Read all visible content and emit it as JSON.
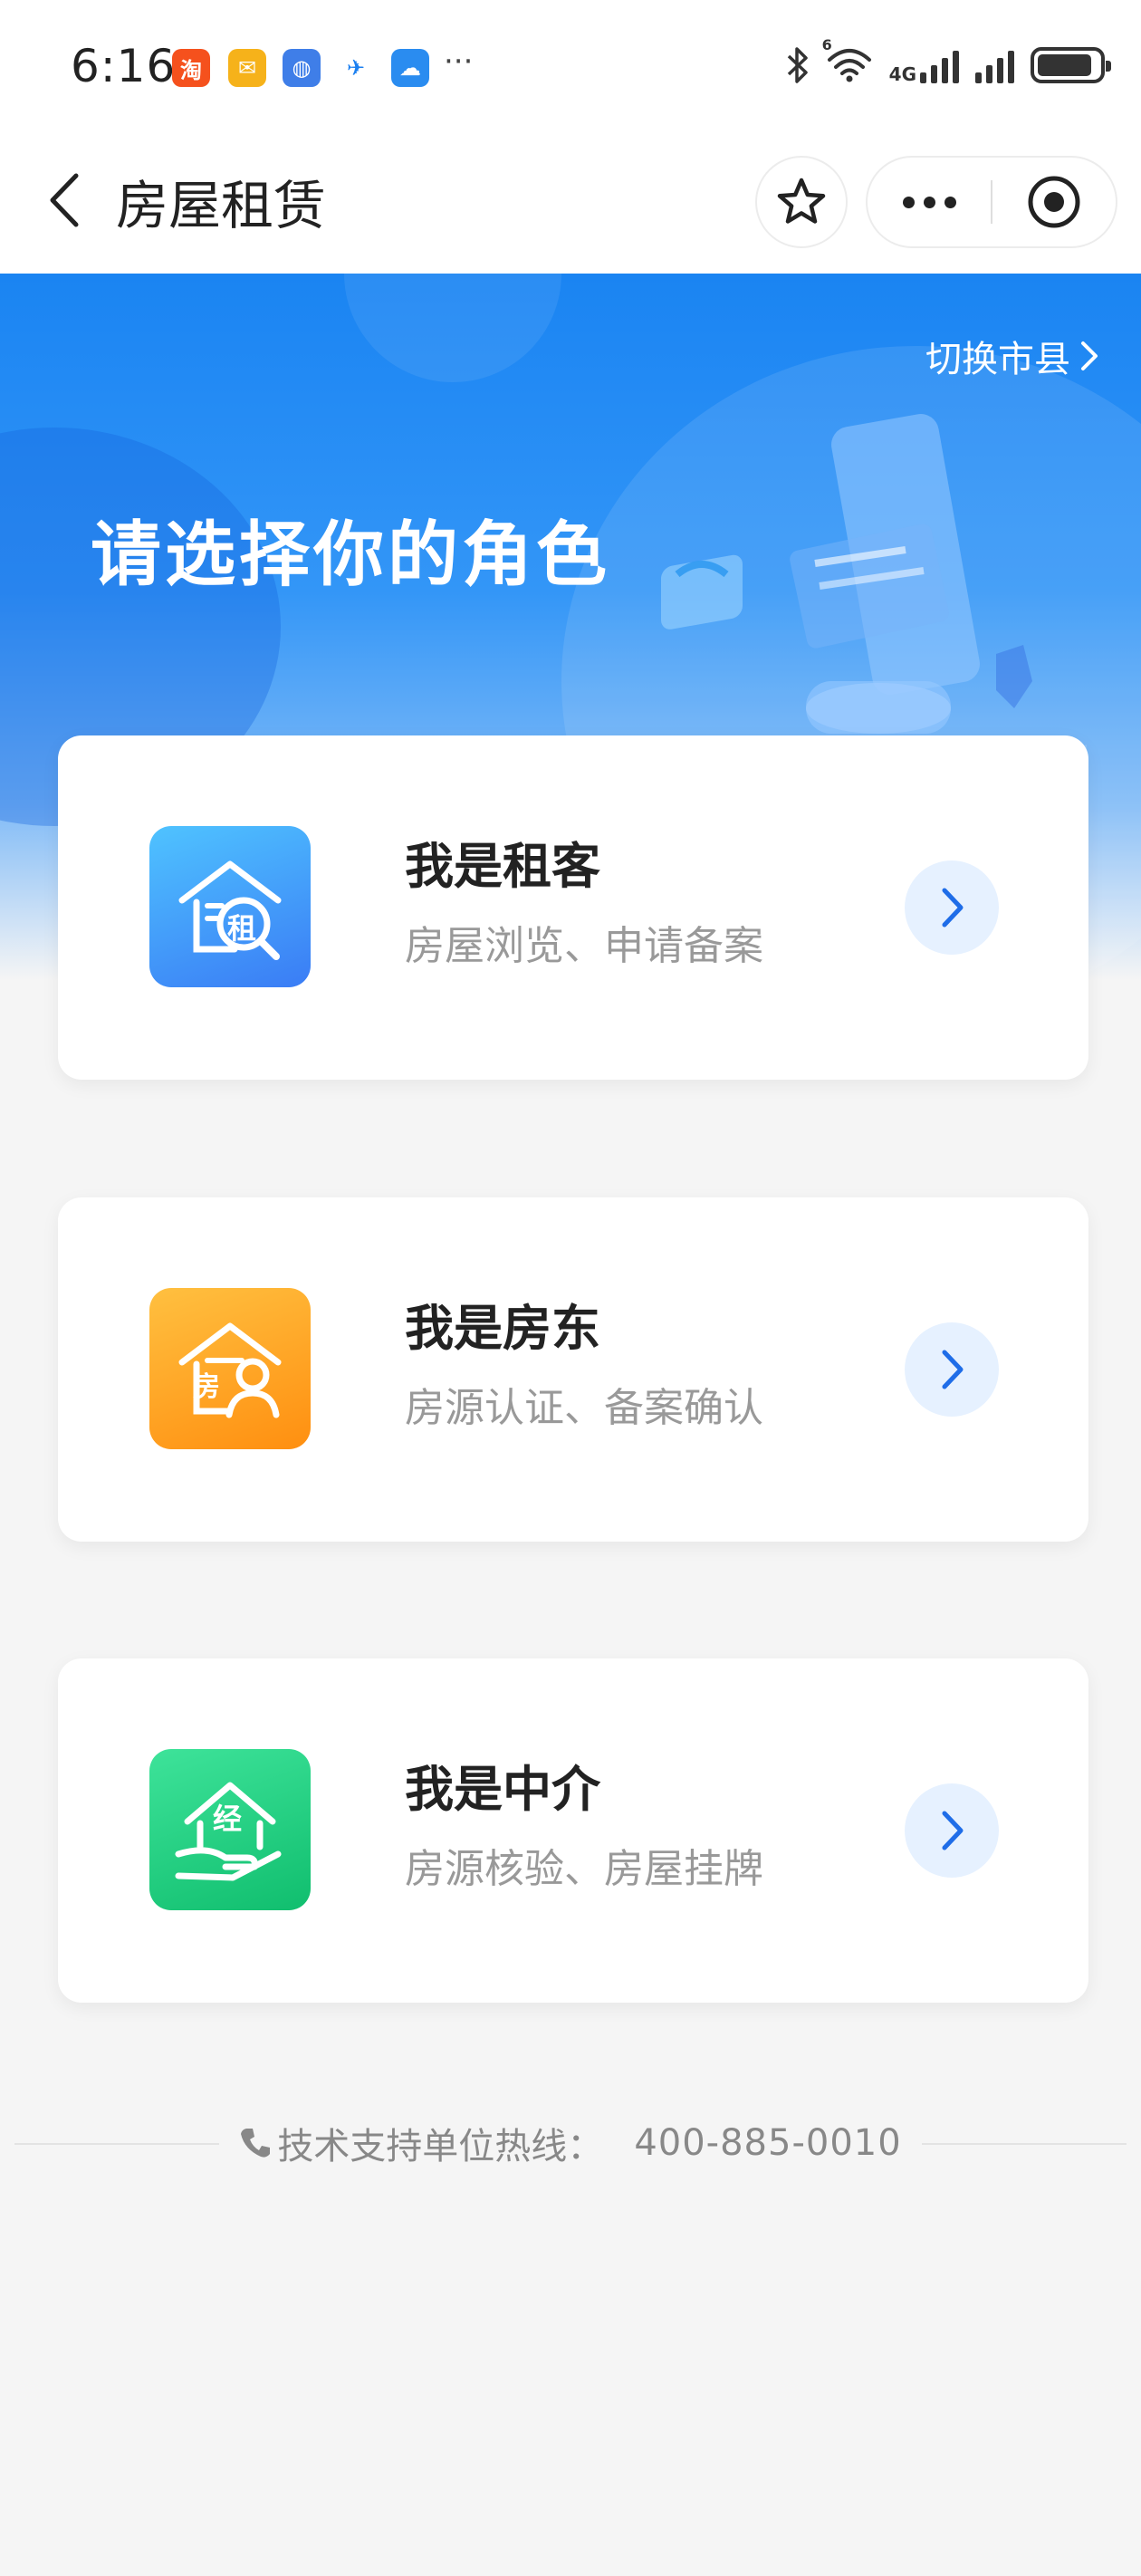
{
  "status_bar": {
    "time": "6:16",
    "apps": [
      {
        "name": "taobao-app-icon",
        "glyph": "淘",
        "color": "#f5511d"
      },
      {
        "name": "mail-app-icon",
        "glyph": "✉",
        "color": "#f6b21a"
      },
      {
        "name": "browser-app-icon",
        "glyph": "◍",
        "color": "#3f7ee8"
      },
      {
        "name": "telecom-app-icon",
        "glyph": "✈",
        "color": "#ffffff"
      },
      {
        "name": "weather-app-icon",
        "glyph": "☁",
        "color": "#2a8cf0"
      }
    ],
    "more": "···",
    "network_label": "4G",
    "wifi_label": "6",
    "battery_level": 0.9
  },
  "nav": {
    "title": "房屋租赁"
  },
  "hero": {
    "switch_city_label": "切换市县",
    "title": "请选择你的角色"
  },
  "roles": [
    {
      "title": "我是租客",
      "subtitle": "房屋浏览、申请备案",
      "icon_glyph": "租",
      "icon_name": "tenant-house-search-icon",
      "gradient": [
        "#4fc3ff",
        "#3a7cf5"
      ]
    },
    {
      "title": "我是房东",
      "subtitle": "房源认证、备案确认",
      "icon_glyph": "房",
      "icon_name": "landlord-house-person-icon",
      "gradient": [
        "#ffc040",
        "#ff8f10"
      ]
    },
    {
      "title": "我是中介",
      "subtitle": "房源核验、房屋挂牌",
      "icon_glyph": "经",
      "icon_name": "agent-house-hand-icon",
      "gradient": [
        "#3ee39a",
        "#10be6e"
      ]
    }
  ],
  "footer": {
    "label": "技术支持单位热线：",
    "phone": "400-885-0010"
  },
  "colors": {
    "accent": "#1a84f2",
    "arrow_bg": "#e6f1ff",
    "arrow": "#1f6de8"
  }
}
